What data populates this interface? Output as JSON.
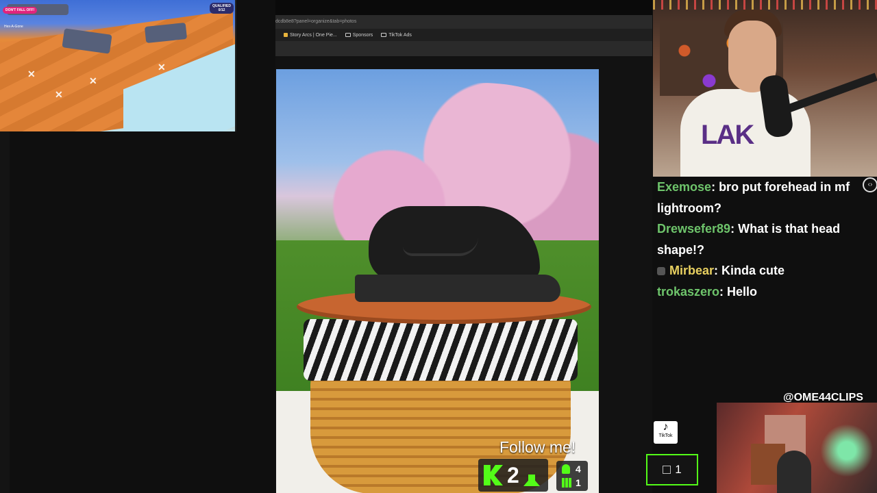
{
  "game": {
    "left_banner": "DON'T FALL OFF!",
    "qualified_label": "QUALIFIED",
    "qualified_count": "0/12",
    "hint": "Hex-A-Gone"
  },
  "browser": {
    "url": "dcdb8e8?panel=organize&tab=photos",
    "bookmarks": [
      {
        "label": "Story Arcs | One Pie..."
      },
      {
        "label": "Sponsors"
      },
      {
        "label": "TikTok Ads"
      }
    ]
  },
  "overlay": {
    "follow_text": "Follow me!",
    "kick_count": "2",
    "stat_top": "4",
    "stat_bottom": "1"
  },
  "chat": {
    "messages": [
      {
        "user": "Exemose",
        "text": "bro put forehead in mf lightroom?"
      },
      {
        "user": "Drewsefer89",
        "text": "What is that head shape!?"
      },
      {
        "user": "Mirbear",
        "text": "Kinda cute"
      },
      {
        "user": "trokaszero",
        "text": "Hello"
      }
    ]
  },
  "handle": "@OME44CLIPS",
  "tiktok_label": "TikTok",
  "viewer_count": "1",
  "colors": {
    "kick_green": "#53fc18",
    "chat_user_green": "#6ec46b",
    "chat_user_gold": "#e8d060"
  }
}
